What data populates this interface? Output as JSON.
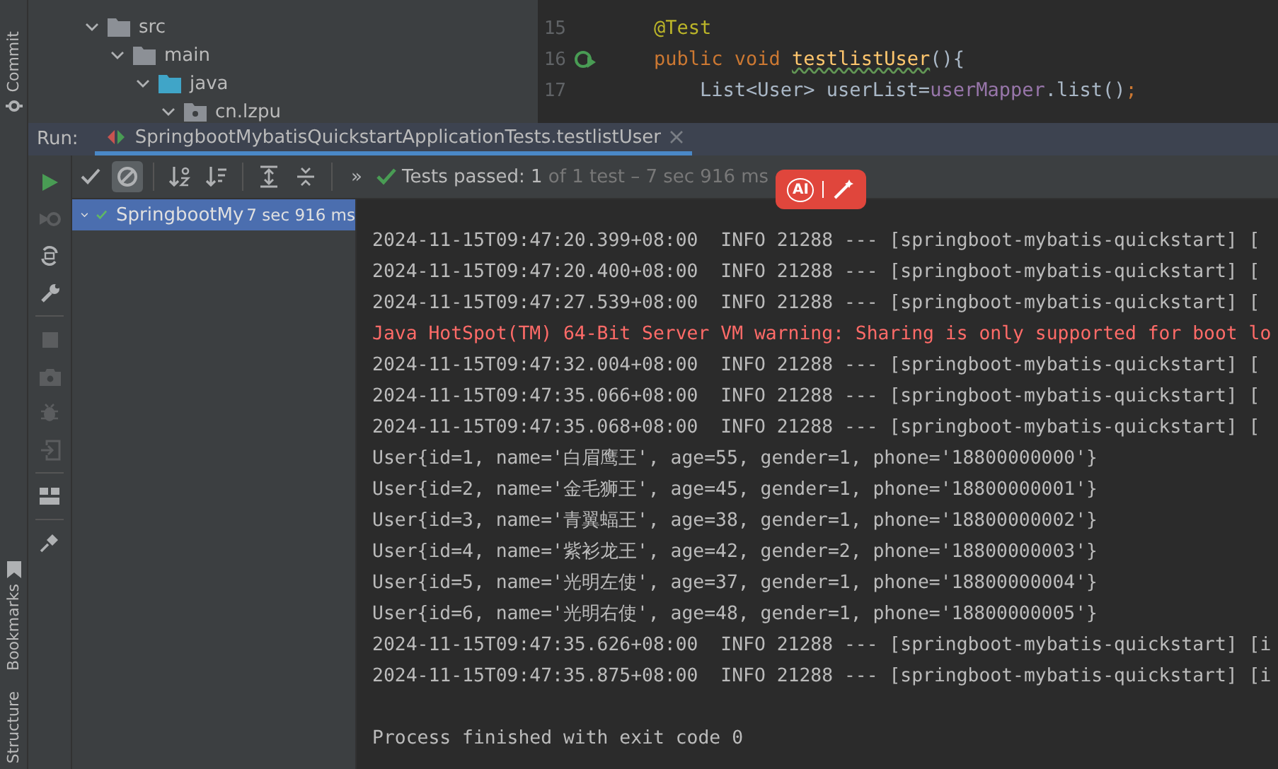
{
  "left_stripe": {
    "top_tabs": [
      {
        "label": "Commit"
      }
    ],
    "bottom_tabs": [
      {
        "label": "Bookmarks",
        "kind": "bookmark"
      },
      {
        "label": "Structure",
        "kind": "plain"
      }
    ]
  },
  "project_tree": [
    {
      "label": "src",
      "kind": "folder",
      "expanded": true,
      "children": [
        {
          "label": "main",
          "kind": "folder",
          "expanded": true,
          "children": [
            {
              "label": "java",
              "kind": "source",
              "expanded": true,
              "children": [
                {
                  "label": "cn.lzpu",
                  "kind": "package",
                  "expanded": true
                }
              ]
            }
          ]
        }
      ]
    }
  ],
  "editor": {
    "lines": [
      {
        "number": "15",
        "run_marker": false,
        "tokens": [
          {
            "text": "@Test",
            "kind": "annotation"
          }
        ]
      },
      {
        "number": "16",
        "run_marker": true,
        "tokens": [
          {
            "text": "public void ",
            "kind": "keyword"
          },
          {
            "text": "testlistUser",
            "kind": "method"
          },
          {
            "text": "(){",
            "kind": "plain"
          }
        ]
      },
      {
        "number": "17",
        "run_marker": false,
        "tokens": [
          {
            "text": "    List<User> userList=",
            "kind": "plain"
          },
          {
            "text": "userMapper",
            "kind": "field"
          },
          {
            "text": ".list()",
            "kind": "plain"
          },
          {
            "text": ";",
            "kind": "keyword"
          }
        ]
      }
    ]
  },
  "run_panel": {
    "label": "Run:",
    "tabs": [
      {
        "title": "SpringbootMybatisQuickstartApplicationTests.testlistUser",
        "selected": true
      }
    ],
    "side_buttons": [
      {
        "kind": "run",
        "disabled": false
      },
      {
        "kind": "rerun-failed",
        "disabled": true
      },
      {
        "kind": "auto-test",
        "disabled": false
      },
      {
        "kind": "settings",
        "disabled": false
      },
      {
        "kind": "separator"
      },
      {
        "kind": "stop",
        "disabled": true
      },
      {
        "kind": "camera",
        "disabled": true
      },
      {
        "kind": "debug",
        "disabled": true
      },
      {
        "kind": "exit",
        "disabled": true
      },
      {
        "kind": "separator"
      },
      {
        "kind": "layout",
        "disabled": false
      },
      {
        "kind": "separator"
      },
      {
        "kind": "pin",
        "disabled": false
      }
    ],
    "toolbar": [
      {
        "kind": "check",
        "selected": false
      },
      {
        "kind": "ignored",
        "selected": true
      },
      {
        "kind": "separator"
      },
      {
        "kind": "sort-alpha",
        "selected": false
      },
      {
        "kind": "sort-duration",
        "selected": false
      },
      {
        "kind": "separator"
      },
      {
        "kind": "expand",
        "selected": false
      },
      {
        "kind": "collapse",
        "selected": false
      },
      {
        "kind": "separator"
      }
    ],
    "more": "»",
    "status": {
      "label": "Tests passed:",
      "count": "1",
      "detail": "of 1 test – 7 sec 916 ms",
      "passed": true
    },
    "test_tree": [
      {
        "name": "SpringbootMy",
        "time": "7 sec 916 ms",
        "passed": true,
        "selected": true,
        "expanded": true
      }
    ],
    "console": [
      {
        "kind": "info",
        "text": "2024-11-15T09:47:20.399+08:00  INFO 21288 --- [springboot-mybatis-quickstart] ["
      },
      {
        "kind": "info",
        "text": "2024-11-15T09:47:20.400+08:00  INFO 21288 --- [springboot-mybatis-quickstart] ["
      },
      {
        "kind": "info",
        "text": "2024-11-15T09:47:27.539+08:00  INFO 21288 --- [springboot-mybatis-quickstart] ["
      },
      {
        "kind": "error",
        "text": "Java HotSpot(TM) 64-Bit Server VM warning: Sharing is only supported for boot lo"
      },
      {
        "kind": "info",
        "text": "2024-11-15T09:47:32.004+08:00  INFO 21288 --- [springboot-mybatis-quickstart] ["
      },
      {
        "kind": "info",
        "text": "2024-11-15T09:47:35.066+08:00  INFO 21288 --- [springboot-mybatis-quickstart] ["
      },
      {
        "kind": "info",
        "text": "2024-11-15T09:47:35.068+08:00  INFO 21288 --- [springboot-mybatis-quickstart] ["
      },
      {
        "kind": "output",
        "text": "User{id=1, name='白眉鹰王', age=55, gender=1, phone='18800000000'}"
      },
      {
        "kind": "output",
        "text": "User{id=2, name='金毛狮王', age=45, gender=1, phone='18800000001'}"
      },
      {
        "kind": "output",
        "text": "User{id=3, name='青翼蝠王', age=38, gender=1, phone='18800000002'}"
      },
      {
        "kind": "output",
        "text": "User{id=4, name='紫衫龙王', age=42, gender=2, phone='18800000003'}"
      },
      {
        "kind": "output",
        "text": "User{id=5, name='光明左使', age=37, gender=1, phone='18800000004'}"
      },
      {
        "kind": "output",
        "text": "User{id=6, name='光明右使', age=48, gender=1, phone='18800000005'}"
      },
      {
        "kind": "info",
        "text": "2024-11-15T09:47:35.626+08:00  INFO 21288 --- [springboot-mybatis-quickstart] [i"
      },
      {
        "kind": "info",
        "text": "2024-11-15T09:47:35.875+08:00  INFO 21288 --- [springboot-mybatis-quickstart] [i"
      },
      {
        "kind": "exit",
        "text": "Process finished with exit code 0"
      }
    ]
  },
  "ai_badge": {
    "label": "AI"
  }
}
